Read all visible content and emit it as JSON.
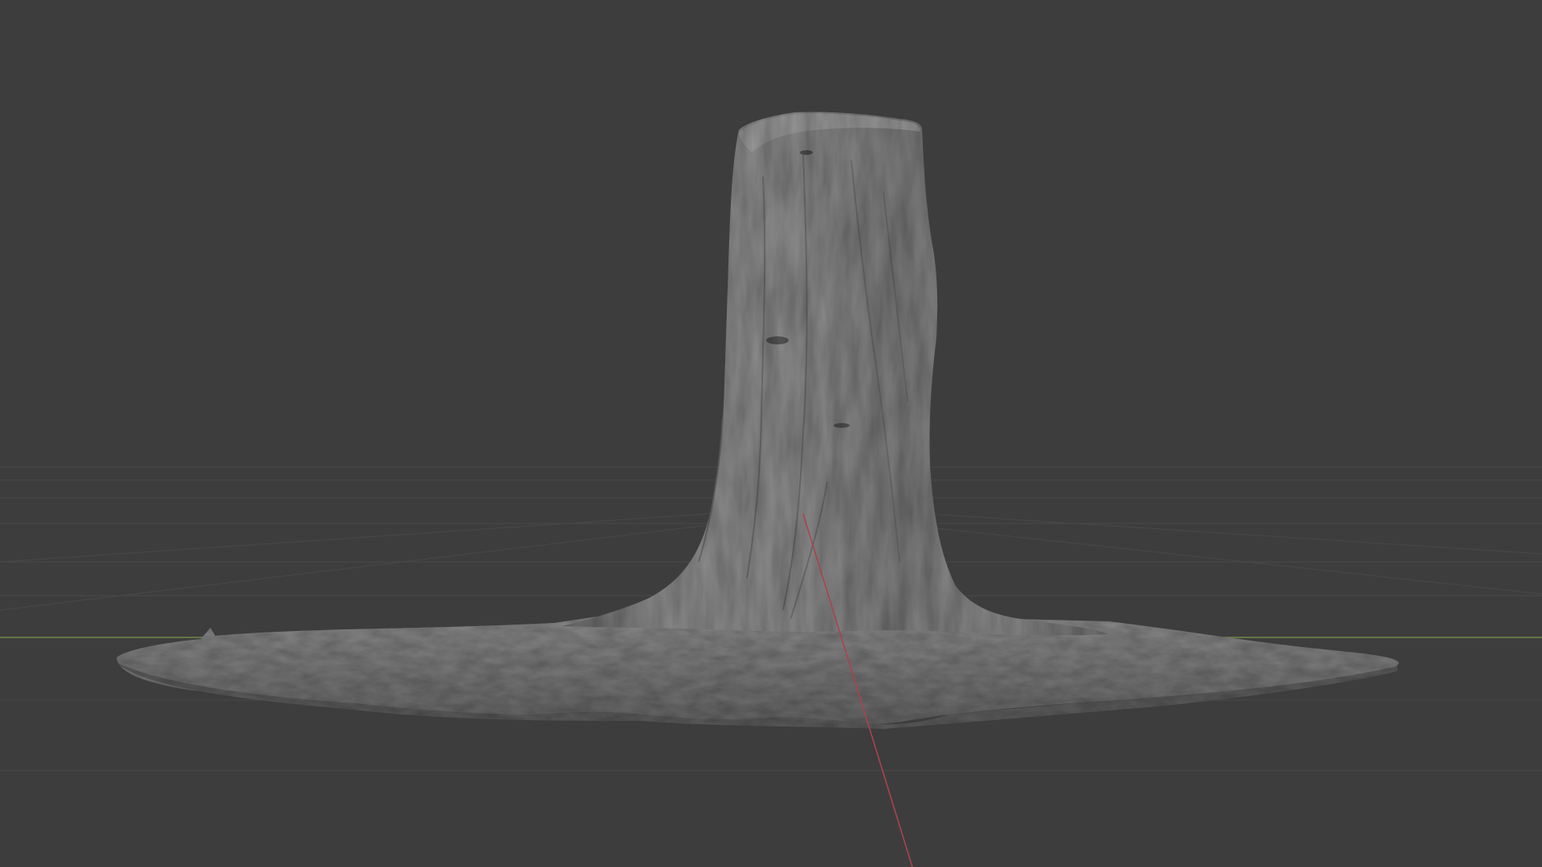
{
  "viewport": {
    "background_color": "#3d3d3d",
    "grid_line_color": "#474747",
    "x_axis_color": "#6e8a4a",
    "y_axis_color": "#a8444a",
    "mesh_color": "#8a8a8a",
    "mesh_shadow_color": "#5c5c5c",
    "object_icon": "tree-stump-mesh"
  }
}
